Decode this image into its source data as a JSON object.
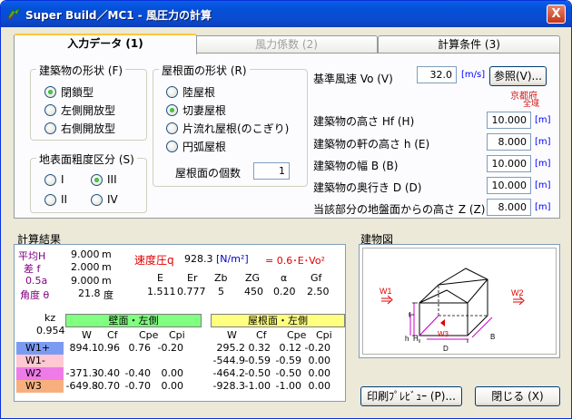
{
  "window": {
    "title": "Super Build／MC1 - 風圧力の計算",
    "close_label": "X"
  },
  "tabs": [
    {
      "label": "入力データ (1)"
    },
    {
      "label": "風力係数 (2)"
    },
    {
      "label": "計算条件 (3)"
    }
  ],
  "building_shape": {
    "title": "建築物の形状 (F)",
    "options": [
      "閉鎖型",
      "左側開放型",
      "右側開放型"
    ],
    "selected": "閉鎖型"
  },
  "roughness": {
    "title": "地表面粗度区分 (S)",
    "options": [
      "I",
      "III",
      "II",
      "IV"
    ],
    "selected": "III"
  },
  "roof_shape": {
    "title": "屋根面の形状 (R)",
    "options": [
      "陸屋根",
      "切妻屋根",
      "片流れ屋根(のこぎり)",
      "円弧屋根"
    ],
    "selected": "切妻屋根",
    "count_label": "屋根面の個数",
    "count_value": "1"
  },
  "inputs": {
    "v0": {
      "label": "基準風速 Vo (V)",
      "value": "32.0",
      "unit": "[m/s]",
      "ref_button": "参照(V)...",
      "region_pref": "京都府",
      "region_area": "全域"
    },
    "hf": {
      "label": "建築物の高さ Hf (H)",
      "value": "10.000",
      "unit": "[m]"
    },
    "h": {
      "label": "建築物の軒の高さ h (E)",
      "value": "8.000",
      "unit": "[m]"
    },
    "b": {
      "label": "建築物の幅 B (B)",
      "value": "10.000",
      "unit": "[m]"
    },
    "d": {
      "label": "建築物の奥行き D (D)",
      "value": "10.000",
      "unit": "[m]"
    },
    "z": {
      "label": "当該部分の地盤面からの高さ Z (Z)",
      "value": "8.000",
      "unit": "[m]"
    }
  },
  "results": {
    "title": "計算結果",
    "avg_h": {
      "label": "平均H",
      "value": "9.000",
      "unit": "m"
    },
    "diff_f": {
      "label": "差 f",
      "value": "2.000",
      "unit": "m"
    },
    "half_a": {
      "label": "0.5a",
      "value": "9.000",
      "unit": "m"
    },
    "angle": {
      "label": "角度 θ",
      "value": "21.8",
      "unit": "度"
    },
    "q": {
      "label": "速度圧q",
      "value": "928.3",
      "unit": "[N/m²]",
      "formula": "= 0.6･E･Vo²"
    },
    "params_headers": [
      "E",
      "Er",
      "Zb",
      "ZG",
      "α",
      "Gf"
    ],
    "params_values": [
      "1.511",
      "0.777",
      "5",
      "450",
      "0.20",
      "2.50"
    ],
    "kz_label": "kz",
    "kz_value": "0.954",
    "wall_header": "壁面・左側",
    "roof_header": "屋根面・左側",
    "col_headers": [
      "W",
      "Cf",
      "Cpe",
      "Cpi"
    ],
    "rows": [
      {
        "label": "W1+",
        "color": "#7b9bf3",
        "wall": [
          "894.1",
          "0.96",
          "0.76",
          "-0.20"
        ],
        "roof": [
          "295.2",
          "0.32",
          "0.12",
          "-0.20"
        ]
      },
      {
        "label": "W1-",
        "color": "#ffc8d2",
        "wall": [
          "",
          "",
          "",
          ""
        ],
        "roof": [
          "-544.9",
          "-0.59",
          "-0.59",
          "0.00"
        ]
      },
      {
        "label": "W2",
        "color": "#ef7be8",
        "wall": [
          "-371.3",
          "-0.40",
          "-0.40",
          "0.00"
        ],
        "roof": [
          "-464.2",
          "-0.50",
          "-0.50",
          "0.00"
        ]
      },
      {
        "label": "W3",
        "color": "#f7b07d",
        "wall": [
          "-649.8",
          "-0.70",
          "-0.70",
          "0.00"
        ],
        "roof": [
          "-928.3",
          "-1.00",
          "-1.00",
          "0.00"
        ]
      }
    ]
  },
  "figure": {
    "title": "建物図",
    "labels": {
      "w1": "W1",
      "w2": "W2",
      "w3": "W3",
      "f": "f",
      "h": "h",
      "H": "H",
      "B": "B",
      "D": "D"
    }
  },
  "buttons": {
    "print_preview": "印刷ﾌﾟﾚﾋﾞｭｰ (P)...",
    "close": "閉じる (X)"
  },
  "colors": {
    "wall_header": "#80ff80",
    "roof_header": "#ffff80",
    "arrow": "#e00000",
    "magenta": "#d000d0"
  }
}
